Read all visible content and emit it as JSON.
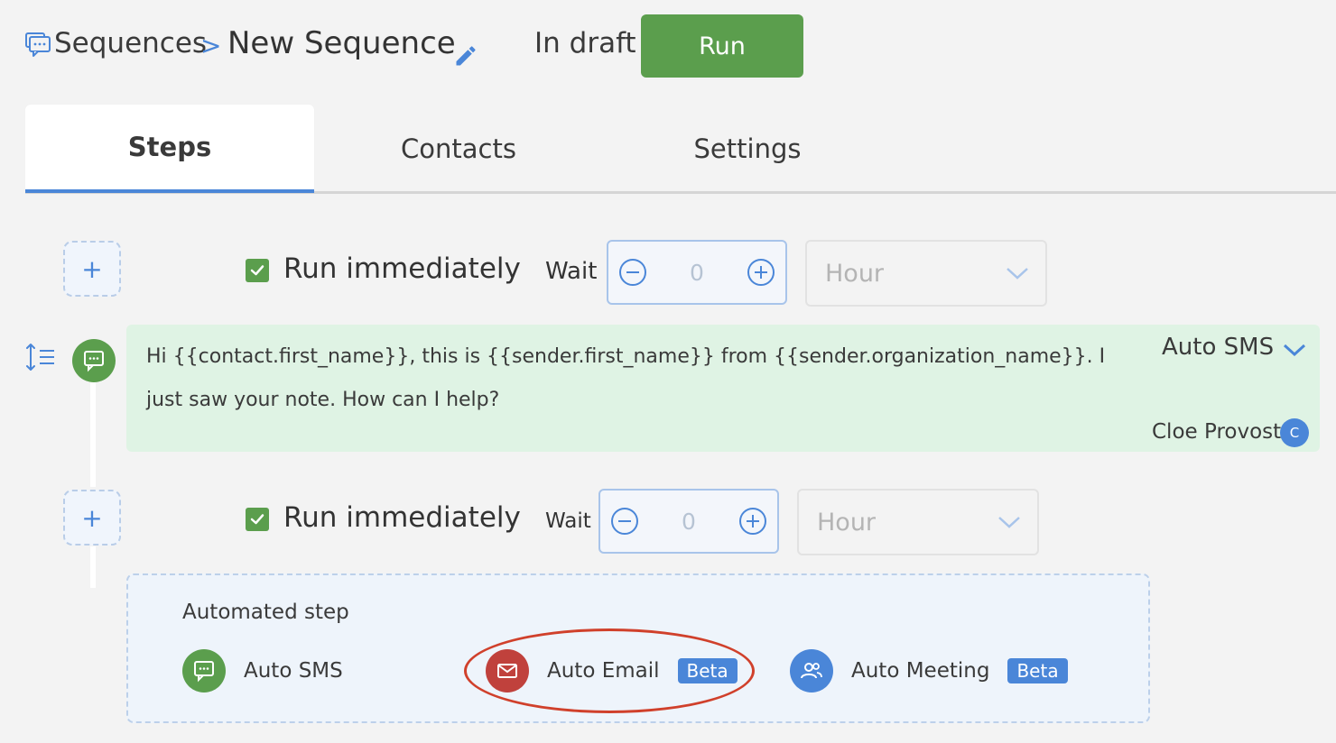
{
  "breadcrumb": {
    "root": "Sequences",
    "separator": ">",
    "current": "New Sequence"
  },
  "status": "In draft",
  "run_button": "Run",
  "tabs": [
    {
      "label": "Steps",
      "active": true
    },
    {
      "label": "Contacts",
      "active": false
    },
    {
      "label": "Settings",
      "active": false
    }
  ],
  "steps": [
    {
      "add_label": "+",
      "run_immediately": "Run immediately",
      "checked": true,
      "wait_label": "Wait",
      "wait_value": "0",
      "unit": "Hour"
    },
    {
      "add_label": "+",
      "run_immediately": "Run immediately",
      "checked": true,
      "wait_label": "Wait",
      "wait_value": "0",
      "unit": "Hour"
    }
  ],
  "message": {
    "text": "Hi {{contact.first_name}}, this is {{sender.first_name}} from {{sender.organization_name}}. I just saw your note. How can I help?",
    "type": "Auto SMS",
    "owner": "Cloe Provost",
    "owner_initial": "C"
  },
  "automated": {
    "title": "Automated step",
    "options": [
      {
        "label": "Auto SMS",
        "icon": "sms-icon",
        "color": "#5b9e4d",
        "badge": ""
      },
      {
        "label": "Auto Email",
        "icon": "email-icon",
        "color": "#c0413c",
        "badge": "Beta"
      },
      {
        "label": "Auto Meeting",
        "icon": "meeting-icon",
        "color": "#4a86d8",
        "badge": "Beta"
      }
    ]
  },
  "colors": {
    "accent": "#4a86d8",
    "success": "#5b9e4d",
    "danger": "#c0413c",
    "highlight": "#d0402b"
  }
}
